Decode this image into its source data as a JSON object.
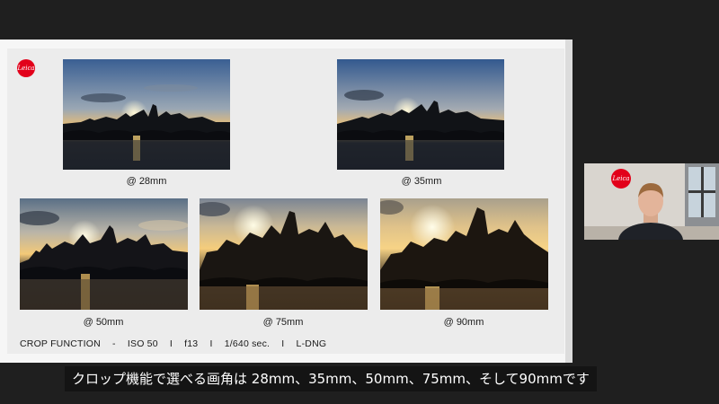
{
  "slide": {
    "logo_text": "Leica",
    "photos": [
      {
        "caption": "@ 28mm"
      },
      {
        "caption": "@ 35mm"
      },
      {
        "caption": "@ 50mm"
      },
      {
        "caption": "@ 75mm"
      },
      {
        "caption": "@ 90mm"
      }
    ],
    "footer": {
      "label": "CROP FUNCTION",
      "sep1": "-",
      "iso": "ISO 50",
      "sep2": "I",
      "aperture": "f13",
      "sep3": "I",
      "shutter": "1/640 sec.",
      "sep4": "I",
      "format": "L-DNG"
    }
  },
  "webcam": {
    "logo_text": "Leica"
  },
  "subtitle": {
    "text": "クロップ機能で選べる画角は 28mm、35mm、50mm、75mm、そして90mmです"
  },
  "colors": {
    "background": "#1f1f1f",
    "slide_bg": "#ececec",
    "leica_red": "#e2001a",
    "subtitle_bg": "#141414"
  }
}
